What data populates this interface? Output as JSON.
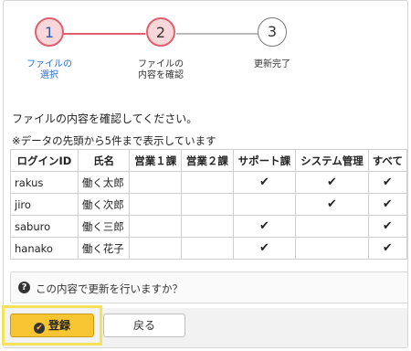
{
  "stepper": {
    "steps": [
      {
        "number": "1",
        "label": "ファイルの\n選択"
      },
      {
        "number": "2",
        "label": "ファイルの\n内容を確認"
      },
      {
        "number": "3",
        "label": "更新完了"
      }
    ]
  },
  "intro_text": "ファイルの内容を確認してください。",
  "note_text": "※データの先頭から5件まで表示しています",
  "table": {
    "headers": [
      "ログインID",
      "氏名",
      "営業１課",
      "営業２課",
      "サポート課",
      "システム管理",
      "すべて"
    ],
    "rows": [
      {
        "login": "rakus",
        "name": "働く太郎",
        "checks": [
          false,
          false,
          true,
          true,
          true
        ]
      },
      {
        "login": "jiro",
        "name": "働く次郎",
        "checks": [
          false,
          false,
          false,
          true,
          true
        ]
      },
      {
        "login": "saburo",
        "name": "働く三郎",
        "checks": [
          false,
          false,
          true,
          false,
          true
        ]
      },
      {
        "login": "hanako",
        "name": "働く花子",
        "checks": [
          false,
          false,
          true,
          false,
          true
        ]
      }
    ],
    "check_glyph": "✔"
  },
  "confirm": {
    "icon": "?",
    "text": "この内容で更新を行いますか？"
  },
  "buttons": {
    "register_label": "登録",
    "back_label": "戻る"
  },
  "colors": {
    "accent": "#e0606d",
    "button_yellow": "#f7c531",
    "highlight": "#f3e25a"
  }
}
